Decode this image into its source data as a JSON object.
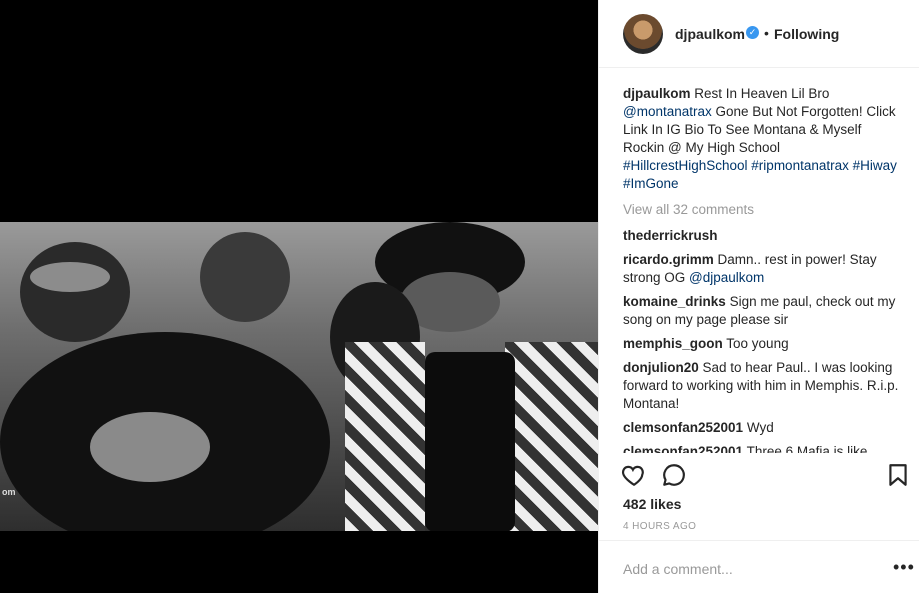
{
  "post": {
    "image_watermark": "om",
    "header": {
      "username": "djpaulkom",
      "verified_icon": "verified-badge-icon",
      "separator": "•",
      "follow_label": "Following"
    },
    "caption": {
      "username": "djpaulkom",
      "text_part1": "Rest In Heaven Lil Bro",
      "mention": "@montanatrax",
      "text_part2": " Gone But Not Forgotten! Click Link In IG Bio ",
      "text_part3": "To See Montana & Myself Rockin @ My High School",
      "hashtags": "#HillcrestHighSchool #ripmontanatrax #Hiway #ImGone"
    },
    "view_all": "View all 32 comments",
    "comments": [
      {
        "user": "thederrickrush",
        "text": "",
        "mention": ""
      },
      {
        "user": "ricardo.grimm",
        "text": "Damn.. rest in power! Stay strong OG ",
        "mention": "@djpaulkom"
      },
      {
        "user": "komaine_drinks",
        "text": "Sign me paul, check out my song on my page please sir",
        "mention": ""
      },
      {
        "user": "memphis_goon",
        "text": "Too young",
        "mention": ""
      },
      {
        "user": "donjulion20",
        "text": "Sad to hear Paul.. I was looking forward to working with him in Memphis. R.i.p. Montana!",
        "mention": ""
      },
      {
        "user": "clemsonfan252001",
        "text": "Wyd",
        "mention": ""
      },
      {
        "user": "clemsonfan252001",
        "text": "Three 6 Mafia is like",
        "mention": ""
      }
    ],
    "likes": "482 likes",
    "time": "4 HOURS AGO",
    "comment_placeholder": "Add a comment...",
    "more_label": "•••",
    "icons": {
      "like": "heart-icon",
      "comment": "comment-bubble-icon",
      "save": "bookmark-icon"
    }
  }
}
